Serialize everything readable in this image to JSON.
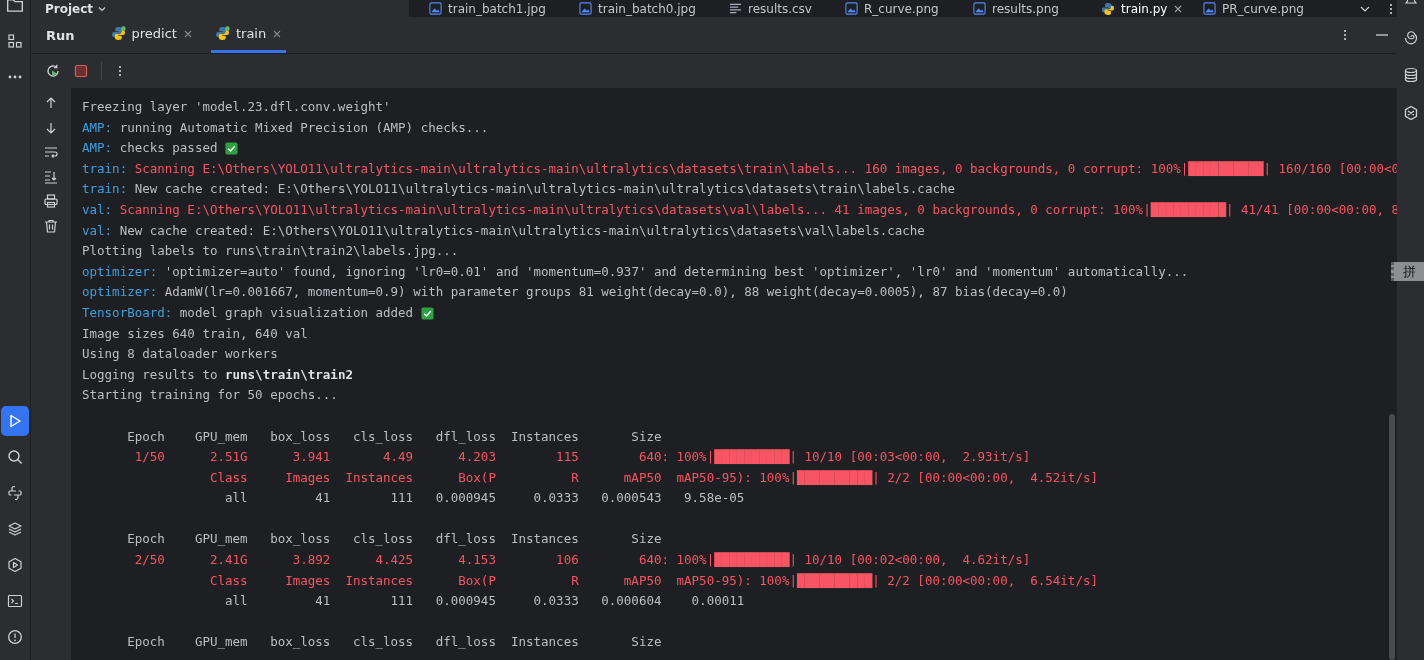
{
  "project_menu": {
    "label": "Project"
  },
  "editor_tabs": [
    {
      "label": "train_batch1.jpg",
      "kind": "image",
      "selected": false
    },
    {
      "label": "train_batch0.jpg",
      "kind": "image",
      "selected": false
    },
    {
      "label": "results.csv",
      "kind": "text",
      "selected": false
    },
    {
      "label": "R_curve.png",
      "kind": "image",
      "selected": false
    },
    {
      "label": "results.png",
      "kind": "image",
      "selected": false
    },
    {
      "label": "train.py",
      "kind": "python",
      "selected": true
    },
    {
      "label": "PR_curve.png",
      "kind": "image",
      "selected": false
    }
  ],
  "left_toolbar_top": [
    {
      "kind": "folder",
      "selected": false
    },
    {
      "kind": "structure",
      "selected": false
    },
    {
      "kind": "more",
      "selected": false
    }
  ],
  "left_toolbar_bottom": [
    {
      "kind": "run",
      "selected": true
    },
    {
      "kind": "search",
      "selected": false
    },
    {
      "kind": "python",
      "selected": false
    },
    {
      "kind": "layers",
      "selected": false
    },
    {
      "kind": "services",
      "selected": false
    },
    {
      "kind": "terminal",
      "selected": false
    },
    {
      "kind": "problems",
      "selected": false
    }
  ],
  "right_toolbar": [
    {
      "kind": "bell"
    },
    {
      "kind": "spiral"
    },
    {
      "kind": "database"
    },
    {
      "kind": "ai"
    }
  ],
  "ime_indicator": "拼",
  "run_panel": {
    "title": "Run",
    "tabs": [
      {
        "label": "predict",
        "selected": false
      },
      {
        "label": "train",
        "selected": true
      }
    ]
  },
  "console_tools": [
    {
      "kind": "up"
    },
    {
      "kind": "down"
    },
    {
      "kind": "wrap"
    },
    {
      "kind": "scroll-end"
    },
    {
      "kind": "print"
    },
    {
      "kind": "trash"
    }
  ],
  "console": {
    "blocks": [
      {
        "lines": [
          {
            "segments": [
              {
                "kind": "text",
                "text": "Freezing layer 'model.23.dfl.conv.weight'"
              }
            ]
          },
          {
            "segments": [
              {
                "kind": "prefix",
                "text": "AMP: "
              },
              {
                "kind": "text",
                "text": "running Automatic Mixed Precision (AMP) checks..."
              }
            ]
          },
          {
            "segments": [
              {
                "kind": "prefix",
                "text": "AMP: "
              },
              {
                "kind": "text",
                "text": "checks passed "
              },
              {
                "kind": "check"
              }
            ]
          },
          {
            "segments": [
              {
                "kind": "prefix",
                "text": "train: "
              },
              {
                "kind": "error",
                "text": "Scanning E:\\Others\\YOLO11\\ultralytics-main\\ultralytics-main\\ultralytics\\datasets\\train\\labels... 160 images, 0 backgrounds, 0 corrupt: 100%|"
              },
              {
                "kind": "bar",
                "text": "██████████"
              },
              {
                "kind": "error",
                "text": "| 160/160 [00:00<0"
              }
            ]
          },
          {
            "segments": [
              {
                "kind": "prefix",
                "text": "train: "
              },
              {
                "kind": "text",
                "text": "New cache created: E:\\Others\\YOLO11\\ultralytics-main\\ultralytics-main\\ultralytics\\datasets\\train\\labels.cache"
              }
            ]
          },
          {
            "segments": [
              {
                "kind": "prefix",
                "text": "val: "
              },
              {
                "kind": "error",
                "text": "Scanning E:\\Others\\YOLO11\\ultralytics-main\\ultralytics-main\\ultralytics\\datasets\\val\\labels... 41 images, 0 backgrounds, 0 corrupt: 100%|"
              },
              {
                "kind": "bar",
                "text": "██████████"
              },
              {
                "kind": "error",
                "text": "| 41/41 [00:00<00:00, 8"
              }
            ]
          },
          {
            "segments": [
              {
                "kind": "prefix",
                "text": "val: "
              },
              {
                "kind": "text",
                "text": "New cache created: E:\\Others\\YOLO11\\ultralytics-main\\ultralytics-main\\ultralytics\\datasets\\val\\labels.cache"
              }
            ]
          },
          {
            "segments": [
              {
                "kind": "text",
                "text": "Plotting labels to runs\\train\\train2\\labels.jpg..."
              }
            ]
          },
          {
            "segments": [
              {
                "kind": "prefix",
                "text": "optimizer: "
              },
              {
                "kind": "text",
                "text": "'optimizer=auto' found, ignoring 'lr0=0.01' and 'momentum=0.937' and determining best 'optimizer', 'lr0' and 'momentum' automatically..."
              }
            ]
          },
          {
            "segments": [
              {
                "kind": "prefix",
                "text": "optimizer: "
              },
              {
                "kind": "text",
                "text": "AdamW(lr=0.001667, momentum=0.9) with parameter groups 81 weight(decay=0.0), 88 weight(decay=0.0005), 87 bias(decay=0.0)"
              }
            ]
          },
          {
            "segments": [
              {
                "kind": "prefix",
                "text": "TensorBoard: "
              },
              {
                "kind": "text",
                "text": "model graph visualization added "
              },
              {
                "kind": "check"
              }
            ]
          },
          {
            "segments": [
              {
                "kind": "text",
                "text": "Image sizes 640 train, 640 val"
              }
            ]
          },
          {
            "segments": [
              {
                "kind": "text",
                "text": "Using 8 dataloader workers"
              }
            ]
          },
          {
            "segments": [
              {
                "kind": "text",
                "text": "Logging results to "
              },
              {
                "kind": "bold",
                "text": "runs\\train\\train2"
              }
            ]
          },
          {
            "segments": [
              {
                "kind": "text",
                "text": "Starting training for 50 epochs..."
              }
            ]
          }
        ]
      },
      {
        "lines": [
          {
            "segments": [
              {
                "kind": "text",
                "text": "      Epoch    GPU_mem   box_loss   cls_loss   dfl_loss  Instances       Size"
              }
            ]
          },
          {
            "segments": [
              {
                "kind": "error",
                "text": "       1/50      2.51G      3.941       4.49      4.203        115        640: 100%|"
              },
              {
                "kind": "bar",
                "text": "██████████"
              },
              {
                "kind": "error",
                "text": "| 10/10 [00:03<00:00,  2.93it/s]"
              }
            ]
          },
          {
            "segments": [
              {
                "kind": "error",
                "text": "                 Class     Images  Instances      Box(P          R      mAP50  mAP50-95): 100%|"
              },
              {
                "kind": "bar",
                "text": "██████████"
              },
              {
                "kind": "error",
                "text": "| 2/2 [00:00<00:00,  4.52it/s]"
              }
            ]
          },
          {
            "segments": [
              {
                "kind": "text",
                "text": "                   all         41        111   0.000945     0.0333   0.000543   9.58e-05"
              }
            ]
          }
        ]
      },
      {
        "lines": [
          {
            "segments": [
              {
                "kind": "text",
                "text": "      Epoch    GPU_mem   box_loss   cls_loss   dfl_loss  Instances       Size"
              }
            ]
          },
          {
            "segments": [
              {
                "kind": "error",
                "text": "       2/50      2.41G      3.892      4.425      4.153        106        640: 100%|"
              },
              {
                "kind": "bar",
                "text": "██████████"
              },
              {
                "kind": "error",
                "text": "| 10/10 [00:02<00:00,  4.62it/s]"
              }
            ]
          },
          {
            "segments": [
              {
                "kind": "error",
                "text": "                 Class     Images  Instances      Box(P          R      mAP50  mAP50-95): 100%|"
              },
              {
                "kind": "bar",
                "text": "██████████"
              },
              {
                "kind": "error",
                "text": "| 2/2 [00:00<00:00,  6.54it/s]"
              }
            ]
          },
          {
            "segments": [
              {
                "kind": "text",
                "text": "                   all         41        111   0.000945     0.0333   0.000604    0.00011"
              }
            ]
          }
        ]
      },
      {
        "lines": [
          {
            "segments": [
              {
                "kind": "text",
                "text": "      Epoch    GPU_mem   box_loss   cls_loss   dfl_loss  Instances       Size"
              }
            ]
          }
        ]
      }
    ]
  }
}
